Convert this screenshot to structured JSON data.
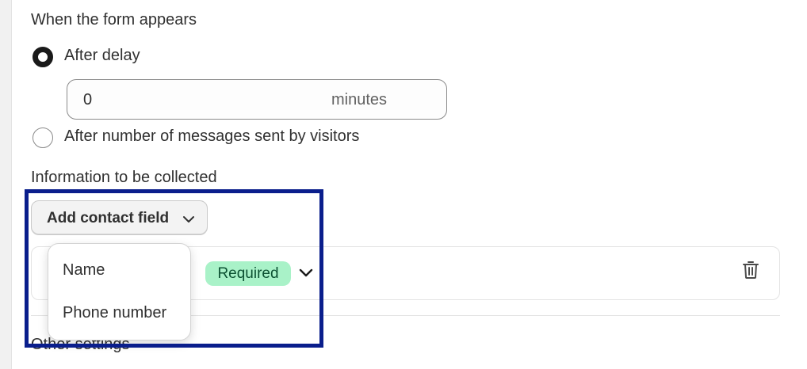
{
  "form_timing": {
    "heading": "When the form appears",
    "option_delay_label": "After delay",
    "option_delay_selected": true,
    "delay_value": "0",
    "delay_unit": "minutes",
    "option_messages_label": "After number of messages sent by visitors",
    "option_messages_selected": false
  },
  "collection": {
    "heading": "Information to be collected",
    "add_button_label": "Add contact field",
    "field_required_badge": "Required",
    "dropdown_items": [
      "Name",
      "Phone number"
    ]
  },
  "other_settings": {
    "heading": "Other settings"
  },
  "icons": {
    "add_button_chevron": "chevron-down-icon",
    "field_chevron": "chevron-down-icon",
    "delete": "trash-icon"
  },
  "colors": {
    "badge_bg": "#a9f2c8",
    "badge_text": "#0c5132",
    "highlight_border": "#0a1e8c"
  }
}
